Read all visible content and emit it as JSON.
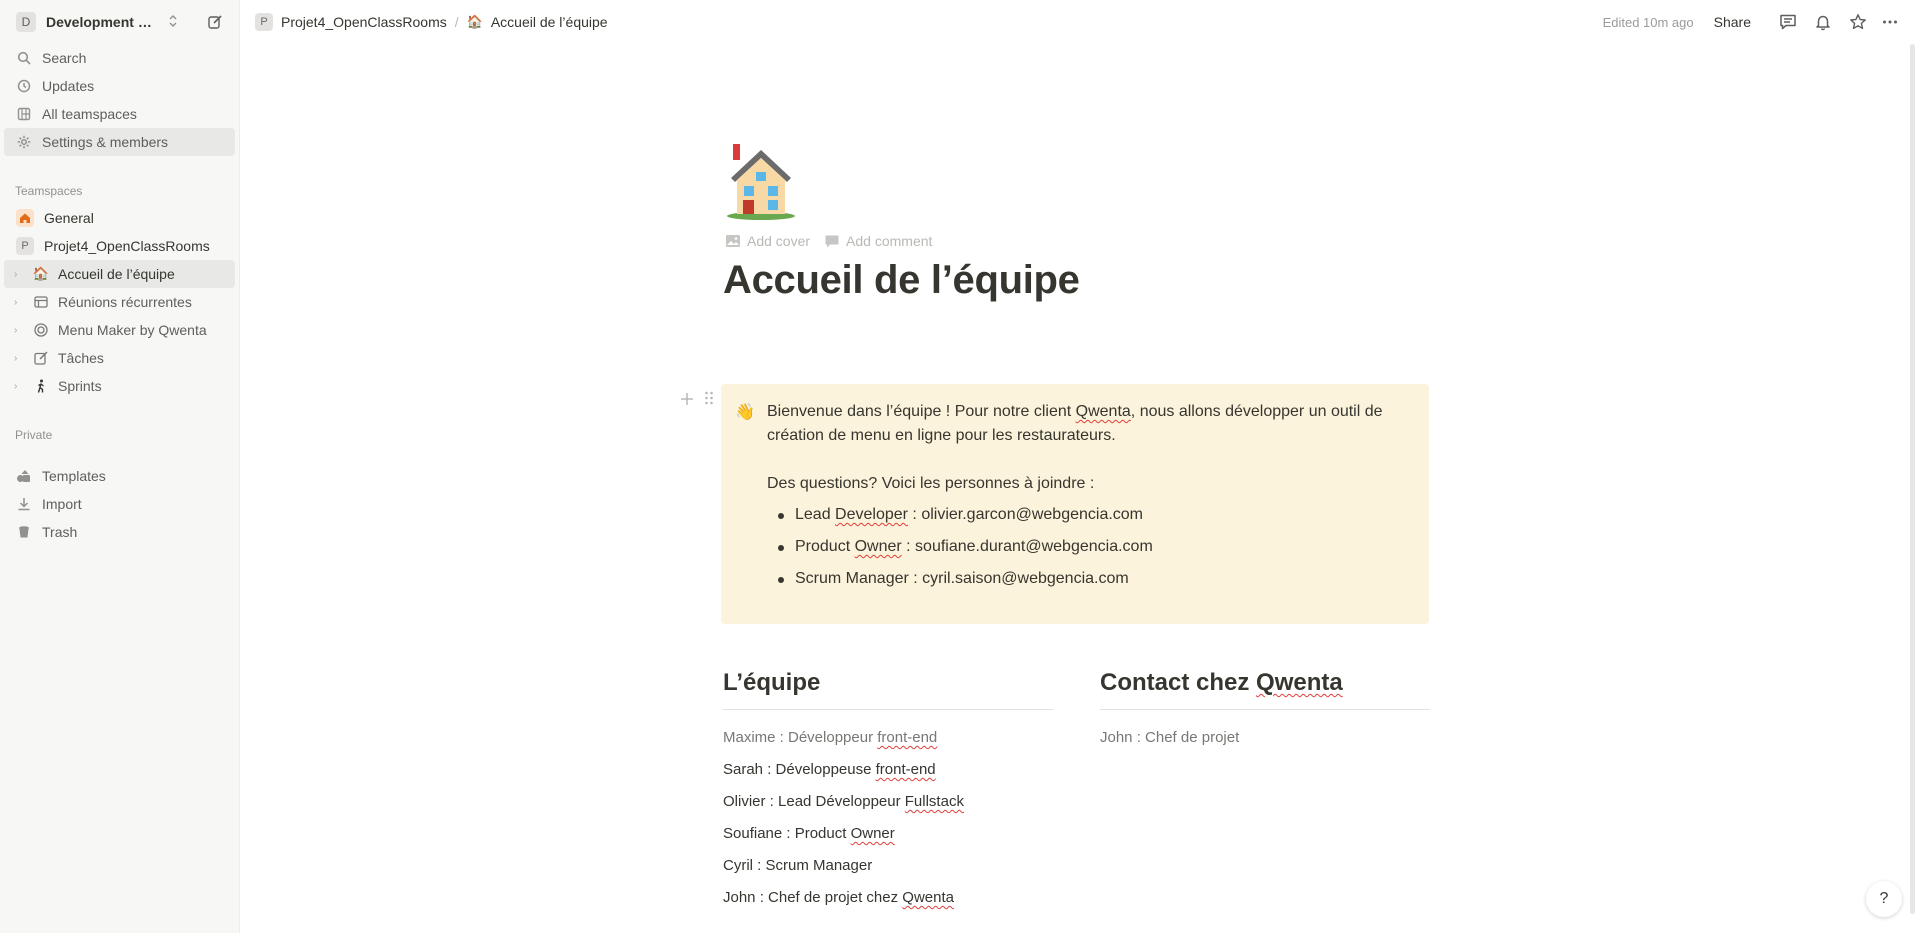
{
  "sidebar": {
    "workspace": {
      "avatar_letter": "D",
      "name": "Development p..."
    },
    "nav": [
      {
        "label": "Search",
        "icon": "search-icon"
      },
      {
        "label": "Updates",
        "icon": "clock-icon"
      },
      {
        "label": "All teamspaces",
        "icon": "grid-icon"
      },
      {
        "label": "Settings & members",
        "icon": "gear-icon"
      }
    ],
    "teamspaces_label": "Teamspaces",
    "teamspaces": [
      {
        "label": "General",
        "icon": "home-icon"
      },
      {
        "label": "Projet4_OpenClassRooms",
        "badge": "P"
      }
    ],
    "pages": [
      {
        "label": "Accueil de l’équipe",
        "icon": "🏠"
      },
      {
        "label": "Réunions récurrentes",
        "icon": "table-icon"
      },
      {
        "label": "Menu Maker by Qwenta",
        "icon": "target-icon"
      },
      {
        "label": "Tâches",
        "icon": "edit-icon"
      },
      {
        "label": "Sprints",
        "icon": "walk-icon"
      }
    ],
    "private_label": "Private",
    "bottom": [
      {
        "label": "Templates",
        "icon": "shapes-icon"
      },
      {
        "label": "Import",
        "icon": "download-icon"
      },
      {
        "label": "Trash",
        "icon": "trash-icon"
      }
    ]
  },
  "topbar": {
    "crumb1_badge": "P",
    "crumb1": "Projet4_OpenClassRooms",
    "separator": "/",
    "crumb2_icon": "🏠",
    "crumb2": "Accueil de l’équipe",
    "edited": "Edited 10m ago",
    "share": "Share"
  },
  "page": {
    "icon": "house-icon",
    "add_cover": "Add cover",
    "add_comment": "Add comment",
    "title": "Accueil de l’équipe",
    "callout": {
      "emoji": "👋",
      "p1_a": "Bienvenue dans l’équipe ! Pour notre client ",
      "p1_b": "Qwenta",
      "p1_c": ", nous allons développer un outil de création de menu en ligne pour les restaurateurs.",
      "p2": "Des questions? Voici les personnes à joindre :",
      "contacts": [
        {
          "a": "Lead ",
          "b": "Developer",
          "c": " : olivier.garcon@webgencia.com"
        },
        {
          "a": "Product ",
          "b": "Owner",
          "c": " : soufiane.durant@webgencia.com"
        },
        {
          "a": "Scrum Manager : cyril.saison@webgencia.com",
          "b": "",
          "c": ""
        }
      ]
    },
    "team": {
      "heading": "L’équipe",
      "rows": [
        {
          "a": "Maxime : Développeur ",
          "b": "front-end"
        },
        {
          "a": "Sarah : Développeuse ",
          "b": "front-end"
        },
        {
          "a": "Olivier : Lead Développeur ",
          "b": "Fullstack"
        },
        {
          "a": "Soufiane : Product ",
          "b": "Owner"
        },
        {
          "a": "Cyril : Scrum Manager",
          "b": ""
        },
        {
          "a": "John : Chef de projet chez ",
          "b": "Qwenta"
        }
      ]
    },
    "contact": {
      "heading_a": "Contact chez ",
      "heading_b": "Qwenta",
      "rows": [
        {
          "a": "John : Chef de projet"
        }
      ]
    }
  },
  "help": "?"
}
